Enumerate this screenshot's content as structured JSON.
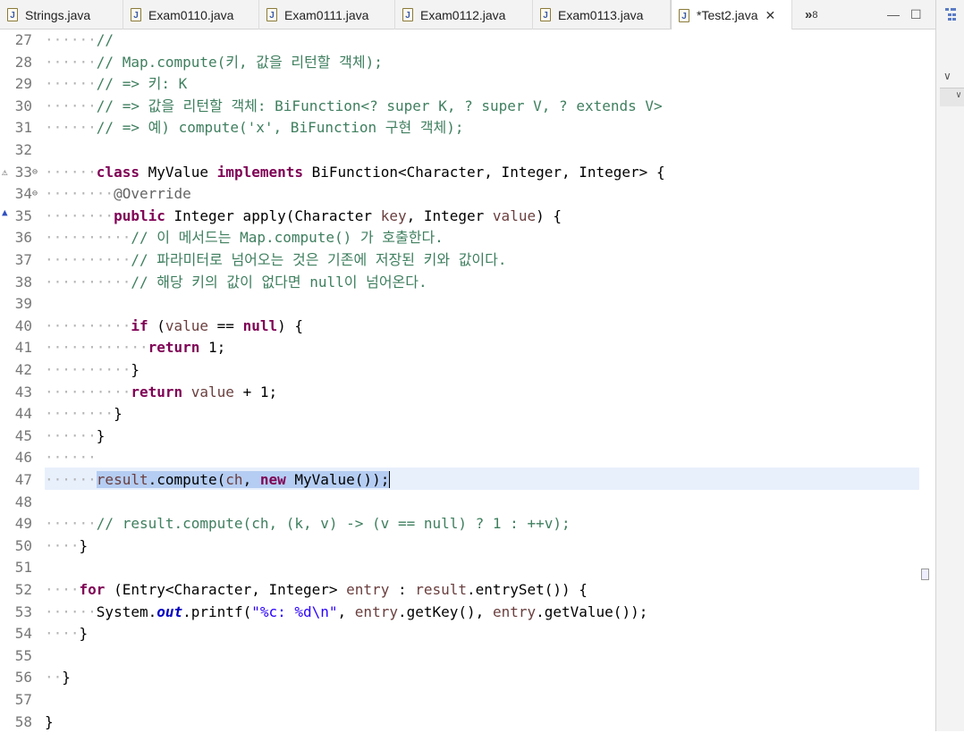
{
  "tabs": [
    {
      "label": "Strings.java",
      "active": false
    },
    {
      "label": "Exam0110.java",
      "active": false
    },
    {
      "label": "Exam0111.java",
      "active": false
    },
    {
      "label": "Exam0112.java",
      "active": false
    },
    {
      "label": "Exam0113.java",
      "active": false
    },
    {
      "label": "*Test2.java",
      "active": true
    }
  ],
  "overflow": {
    "symbol": "»",
    "count": "8"
  },
  "lines": [
    {
      "n": "27"
    },
    {
      "n": "28"
    },
    {
      "n": "29"
    },
    {
      "n": "30"
    },
    {
      "n": "31"
    },
    {
      "n": "32"
    },
    {
      "n": "33"
    },
    {
      "n": "34"
    },
    {
      "n": "35"
    },
    {
      "n": "36"
    },
    {
      "n": "37"
    },
    {
      "n": "38"
    },
    {
      "n": "39"
    },
    {
      "n": "40"
    },
    {
      "n": "41"
    },
    {
      "n": "42"
    },
    {
      "n": "43"
    },
    {
      "n": "44"
    },
    {
      "n": "45"
    },
    {
      "n": "46"
    },
    {
      "n": "47"
    },
    {
      "n": "48"
    },
    {
      "n": "49"
    },
    {
      "n": "50"
    },
    {
      "n": "51"
    },
    {
      "n": "52"
    },
    {
      "n": "53"
    },
    {
      "n": "54"
    },
    {
      "n": "55"
    },
    {
      "n": "56"
    },
    {
      "n": "57"
    },
    {
      "n": "58"
    }
  ],
  "code": {
    "l27": "//",
    "l28": "// Map.compute(키, 값을 리턴할 객체);",
    "l29": "// => 키: K",
    "l30": "// => 값을 리턴할 객체: BiFunction<? super K, ? super V, ? extends V>",
    "l31": "// => 예) compute('x', BiFunction 구현 객체);",
    "l33_kw1": "class",
    "l33_a": " MyValue ",
    "l33_kw2": "implements",
    "l33_b": " BiFunction<Character, Integer, Integer> {",
    "l34": "@Override",
    "l35_kw": "public",
    "l35_a": " Integer apply(Character ",
    "l35_v1": "key",
    "l35_b": ", Integer ",
    "l35_v2": "value",
    "l35_c": ") {",
    "l36": "// 이 메서드는 Map.compute() 가 호출한다.",
    "l37": "// 파라미터로 넘어오는 것은 기존에 저장된 키와 값이다.",
    "l38": "// 해당 키의 값이 없다면 null이 넘어온다.",
    "l40_kw": "if",
    "l40_a": " (",
    "l40_v": "value",
    "l40_b": " == ",
    "l40_kw2": "null",
    "l40_c": ") {",
    "l41_kw": "return",
    "l41_a": " 1;",
    "l42": "}",
    "l43_kw": "return",
    "l43_a": " ",
    "l43_v": "value",
    "l43_b": " + 1;",
    "l44": "}",
    "l45": "}",
    "l47_v1": "result",
    "l47_a": ".compute(",
    "l47_v2": "ch",
    "l47_b": ", ",
    "l47_kw": "new",
    "l47_c": " MyValue());",
    "l49": "// result.compute(ch, (k, v) -> (v == null) ? 1 : ++v);",
    "l50": "}",
    "l52_kw": "for",
    "l52_a": " (Entry<Character, Integer> ",
    "l52_v1": "entry",
    "l52_b": " : ",
    "l52_v2": "result",
    "l52_c": ".entrySet()) {",
    "l53_a": "System.",
    "l53_f": "out",
    "l53_b": ".printf(",
    "l53_s": "\"%c: %d\\n\"",
    "l53_c": ", ",
    "l53_v1": "entry",
    "l53_d": ".getKey(), ",
    "l53_v2": "entry",
    "l53_e": ".getValue());",
    "l54": "}",
    "l56": "}",
    "l58": "}"
  }
}
